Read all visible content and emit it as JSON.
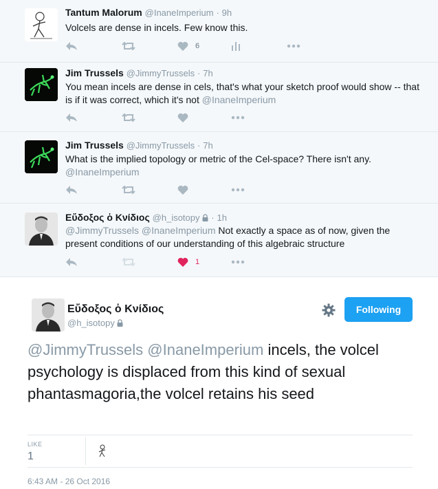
{
  "tweets": [
    {
      "name": "Tantum Malorum",
      "handle": "@InaneImperium",
      "time": "9h",
      "text_plain": "Volcels are dense in incels.  Few know this.",
      "likes": "6"
    },
    {
      "name": "Jim Trussels",
      "handle": "@JimmyTrussels",
      "time": "7h",
      "text_plain": "You mean incels are dense in cels, that's what your sketch proof would show -- that is if it was correct, which it's not",
      "text_mention": "@InaneImperium"
    },
    {
      "name": "Jim Trussels",
      "handle": "@JimmyTrussels",
      "time": "7h",
      "text_plain": "What is the implied topology or metric of the Cel-space? There isn't any.",
      "text_mention": "@InaneImperium"
    },
    {
      "name": "Εὔδοξος ὁ Κνίδιος",
      "handle": "@h_isotopy",
      "time": "1h",
      "text_mention": "@JimmyTrussels @InaneImperium",
      "text_plain": "Not exactly a space as of now, given the present conditions of our understanding of this algebraic structure",
      "likes": "1"
    }
  ],
  "main": {
    "name": "Εὔδοξος ὁ Κνίδιος",
    "handle": "@h_isotopy",
    "follow_label": "Following",
    "text_mention": "@JimmyTrussels @InaneImperium",
    "text_plain": "incels, the volcel psychology is displaced from this kind of sexual phantasmagoria,the volcel retains his seed",
    "like_label": "LIKE",
    "like_count": "1",
    "timestamp": "6:43 AM - 26 Oct 2016"
  },
  "separator": "·",
  "colors": {
    "accent": "#1da1f2",
    "liked": "#e0245e",
    "muted": "#8899a6",
    "action_icon": "#aab8c2"
  },
  "icons": [
    "reply-icon",
    "retweet-icon",
    "heart-icon",
    "analytics-icon",
    "more-icon",
    "lock-icon",
    "gear-icon"
  ]
}
